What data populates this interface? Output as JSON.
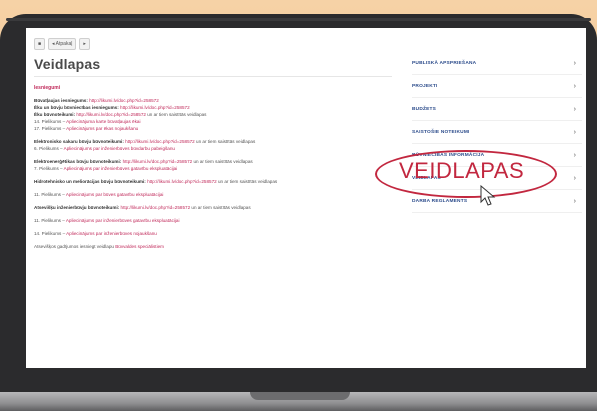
{
  "toolbar": {
    "menu_icon": "menu-icon",
    "back_label": "◂ Atpakaļ",
    "forward_label": "▸"
  },
  "page": {
    "title": "Veidlapas",
    "subtitle": "Iesniegumi"
  },
  "content": {
    "blocks": [
      {
        "lines": [
          {
            "bold": "Būvatļaujas iesniegums:",
            "link": "http://likumi.lv/doc.php?id=258572"
          },
          {
            "bold": "Ēku un būvju būvniecības iesniegums:",
            "link": "http://likumi.lv/doc.php?id=258572"
          },
          {
            "bold": "Ēku būvnoteikumi:",
            "link": "http://likumi.lv/doc.php?id=258572",
            "text": " un ar tiem saistītās veidlapas"
          },
          {
            "text": "14. Pielikums – ",
            "link": "Apliecinājuma karte būvatļaujas ēkai"
          },
          {
            "text": "17. Pielikums – ",
            "link": "Apliecinājums par ēkas nojaukšanu"
          }
        ]
      },
      {
        "lines": [
          {
            "bold": "Elektronisko sakaru būvju būvnoteikumi:",
            "link": "http://likumi.lv/doc.php?id=258572",
            "text": " un ar tiem saistītās veidlapas"
          },
          {
            "text": "6. Pielikums – ",
            "link": "Apliecinājums par inženierbūves būvdarbu pabeigšanu"
          }
        ]
      },
      {
        "lines": [
          {
            "bold": "Elektroenerģētikas būvju būvnoteikumi:",
            "link": "http://likumi.lv/doc.php?id=258572",
            "text": " un ar tiem saistītās veidlapas"
          },
          {
            "text": "7. Pielikums – ",
            "link": "Apliecinājums par inženierbūves gatavību ekspluatācijai"
          }
        ]
      },
      {
        "lines": [
          {
            "bold": "Hidrotehnisko un meliorācijas būvju būvnoteikumi:",
            "link": "http://likumi.lv/doc.php?id=258572",
            "text": " un ar tiem saistītās veidlapas"
          }
        ]
      },
      {
        "lines": [
          {
            "text": "11. Pielikums – ",
            "link": "Apliecinājums par būves gatavību ekspluatācijai"
          }
        ]
      },
      {
        "lines": [
          {
            "bold": "Atsevišķu inženierbūvju būvnoteikumi:",
            "link": "http://likumi.lv/doc.php?id=258572",
            "text": " un ar tiem saistītās veidlapas"
          }
        ]
      },
      {
        "lines": [
          {
            "text": "11. Pielikums – ",
            "link": "Apliecinājums par inženierbūves gatavību ekspluatācijai"
          }
        ]
      },
      {
        "lines": [
          {
            "text": "14. Pielikums – ",
            "link": "Apliecinājums par inženierbūves nojaukšanu"
          }
        ]
      },
      {
        "lines": [
          {
            "text": "Atsevišķos gadījumos iesniegt veidlapu ",
            "link": "Būvvaldes speciālistiem"
          }
        ]
      }
    ]
  },
  "sidebar": {
    "items": [
      {
        "label": "PUBLISKĀ APSPRIEŠANA",
        "chevron": "›"
      },
      {
        "label": "PROJEKTI",
        "chevron": "›"
      },
      {
        "label": "BUDŽETS",
        "chevron": "›"
      },
      {
        "label": "SAISTOŠIE NOTEIKUMI",
        "chevron": "›"
      },
      {
        "label": "BŪVNIECĪBAS INFORMĀCIJA",
        "chevron": "›"
      },
      {
        "label": "VEIDLAPAS",
        "chevron": "›"
      },
      {
        "label": "DARBA REGLAMENTS",
        "chevron": "›"
      }
    ]
  },
  "callout": {
    "text": "VEIDLAPAS",
    "color": "#c2273f"
  },
  "colors": {
    "link": "#c0295a",
    "nav": "#2a4a8a",
    "background": "#f3c89a"
  }
}
